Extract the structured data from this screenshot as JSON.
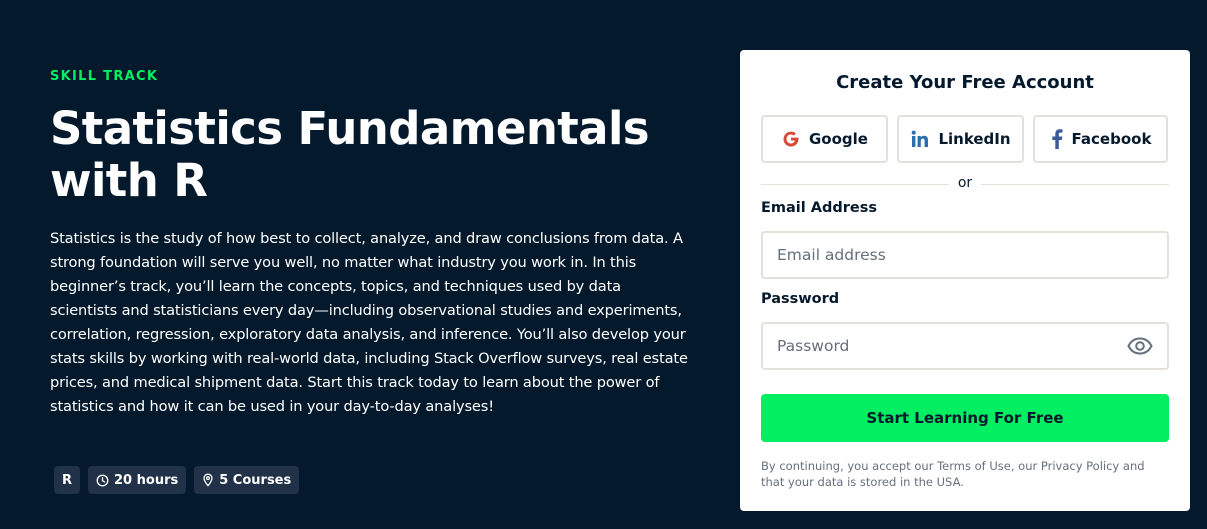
{
  "hero": {
    "eyebrow": "SKILL TRACK",
    "title": "Statistics Fundamentals with R",
    "description": "Statistics is the study of how best to collect, analyze, and draw conclusions from data. A strong foundation will serve you well, no matter what industry you work in. In this beginner’s track, you’ll learn the concepts, topics, and techniques used by data scientists and statisticians every day—including observational studies and experiments, correlation, regression, exploratory data analysis, and inference. You’ll also develop your stats skills by working with real-world data, including Stack Overflow surveys, real estate prices, and medical shipment data. Start this track today to learn about the power of statistics and how it can be used in your day-to-day analyses!",
    "tags": {
      "technology": "R",
      "duration": "20 hours",
      "courses": "5 Courses"
    }
  },
  "signup": {
    "title": "Create Your Free Account",
    "social": {
      "google": "Google",
      "linkedin": "LinkedIn",
      "facebook": "Facebook"
    },
    "divider": "or",
    "email_label": "Email Address",
    "email_placeholder": "Email address",
    "password_label": "Password",
    "password_placeholder": "Password",
    "cta": "Start Learning For Free",
    "legal": "By continuing, you accept our Terms of Use, our Privacy Policy and that your data is stored in the USA."
  },
  "colors": {
    "background": "#05192d",
    "accent": "#03ef62",
    "tag_bg": "#213147"
  },
  "icons": {
    "duration": "clock-icon",
    "courses": "location-pin-icon",
    "google": "google-icon",
    "linkedin": "linkedin-icon",
    "facebook": "facebook-icon",
    "password_toggle": "eye-icon"
  }
}
